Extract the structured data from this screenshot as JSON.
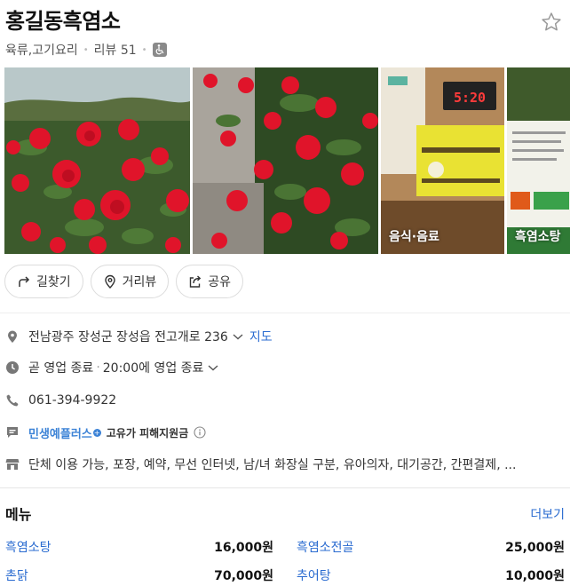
{
  "place": {
    "name": "홍길동흑염소",
    "category": "육류,고기요리",
    "review_label": "리뷰 51"
  },
  "photos": [
    {
      "label": ""
    },
    {
      "label": ""
    },
    {
      "label": "음식·음료",
      "clock": "5:20"
    },
    {
      "label": "흑염소탕"
    }
  ],
  "actions": {
    "directions": "길찾기",
    "streetview": "거리뷰",
    "share": "공유"
  },
  "info": {
    "address": "전남광주 장성군 장성읍 전고개로 236",
    "map_link": "지도",
    "status": "곧 영업 종료",
    "hours": "20:00에 영업 종료",
    "phone": "061-394-9922",
    "promo_brand": "민생예플러스",
    "promo_text": "고유가 피해지원금",
    "facilities": "단체 이용 가능, 포장, 예약, 무선 인터넷, 남/녀 화장실 구분, 유아의자, 대기공간, 간편결제, ..."
  },
  "menu": {
    "title": "메뉴",
    "more": "더보기",
    "items": [
      {
        "name": "흑염소탕",
        "price": "16,000원"
      },
      {
        "name": "흑염소전골",
        "price": "25,000원"
      },
      {
        "name": "촌닭",
        "price": "70,000원"
      },
      {
        "name": "추어탕",
        "price": "10,000원"
      }
    ]
  },
  "colors": {
    "link": "#2a6bd0",
    "promo": "#3b82d6",
    "rose": "#e0142a"
  }
}
